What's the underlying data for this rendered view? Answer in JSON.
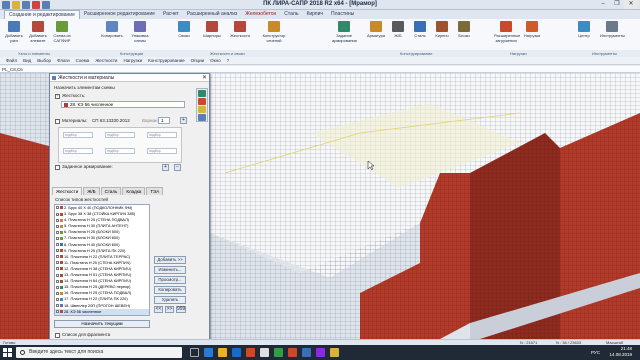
{
  "app": {
    "title": "ПК ЛИРА-САПР  2018 R2 x64 - [Мрамор]",
    "window_controls": [
      "–",
      "❐",
      "✕"
    ]
  },
  "ribbon": {
    "tabs": [
      {
        "label": "Создание и редактирование",
        "active": true
      },
      {
        "label": "Расширенное редактирование"
      },
      {
        "label": "Расчет"
      },
      {
        "label": "Расширенный анализ"
      },
      {
        "label": "Железобетон"
      },
      {
        "label": "Сталь"
      },
      {
        "label": "Кирпич"
      },
      {
        "label": "Пластины"
      }
    ],
    "buttons": [
      {
        "label": "Добавить узел",
        "color": "#4a7ab8"
      },
      {
        "label": "Добавить элемент",
        "color": "#b5473b"
      },
      {
        "label": "Схема из САПФИР",
        "color": "#6a9a3a"
      },
      {
        "label": "Копировать",
        "color": "#5f86c2"
      },
      {
        "label": "Упаковка схемы",
        "color": "#6d6db5"
      },
      {
        "label": "Связи",
        "color": "#3b8cc2"
      },
      {
        "label": "Шарниры",
        "color": "#b5473b"
      },
      {
        "label": "Конструктор сечений",
        "color": "#c98a2a"
      },
      {
        "label": "Задание армирования",
        "color": "#2f8a6a"
      },
      {
        "label": "Жесткости",
        "color": "#b5473b"
      },
      {
        "label": "Арматура",
        "color": "#c98a2a"
      },
      {
        "label": "Ж/Б",
        "color": "#5a5a5a"
      },
      {
        "label": "Сталь",
        "color": "#3b6fb5"
      },
      {
        "label": "Кирпич",
        "color": "#a0522d"
      },
      {
        "label": "Блоки",
        "color": "#7b6a3a"
      },
      {
        "label": "Расширенные загружения",
        "color": "#c94a2a"
      },
      {
        "label": "Нагрузки",
        "color": "#d25a2a"
      },
      {
        "label": "Центр",
        "color": "#3b8cc2"
      },
      {
        "label": "Инструменты",
        "color": "#6a7a8a"
      }
    ],
    "group_labels": [
      "Узлы и элементы",
      "Конструкция",
      "Жесткости и связи",
      "Конструирование",
      "Нагрузки",
      "Инструменты"
    ]
  },
  "menubar": {
    "items": [
      "Файл",
      "Вид",
      "Выбор",
      "Флаги",
      "Схема",
      "Жесткости",
      "Нагрузки",
      "Конструирование",
      "Опции",
      "Окно",
      "?"
    ]
  },
  "document": {
    "tab_label": "PL_C8,C6"
  },
  "dialog": {
    "title": "Жесткости и материалы",
    "assign_header": "Назначить элементам схемы",
    "stiffness_checkbox": "Жесткость:",
    "stiffness_value": "28. КЭ 56 численное",
    "materials_checkbox": "Материалы:",
    "materials_value": "СП 63.13330.2012",
    "variant_label": "Вариант",
    "variant_value": "1",
    "subfields": [
      "подбор",
      "подбор",
      "подбор",
      "подбор",
      "подбор",
      "подбор"
    ],
    "reinforcement_checkbox": "Заданное армирование:",
    "tabs": [
      "Жесткости",
      "Ж/Б",
      "Сталь",
      "Кладка",
      "ТЭА"
    ],
    "list_title": "Список типов жесткостей",
    "list_items": [
      {
        "text": "2. Брус 40 X 40 (ПОДКОЛОННИК ФМ)",
        "color": "#b5473b"
      },
      {
        "text": "3. Брус 38 X 38 (СТОЙКА КИРПИЧ 38б)",
        "color": "#b5473b"
      },
      {
        "text": "4. Пластина H 25 (СТЕНА ПОДВАЛ)",
        "color": "#c98a2a"
      },
      {
        "text": "5. Пластина H 30 (ПЛИТА АНТЕНТ)",
        "color": "#c98a2a"
      },
      {
        "text": "6. Пластина H 25 (БЛОКИ 500)",
        "color": "#6a9a3a"
      },
      {
        "text": "7. Пластина H 30 (БЛОКИ 600)",
        "color": "#6a9a3a"
      },
      {
        "text": "8. Пластина H 40 (БЛОКИ 600)",
        "color": "#3b6fb5"
      },
      {
        "text": "9. Пластина H 25 (ПЛИТА ПК 220)",
        "color": "#c94a2a"
      },
      {
        "text": "10. Пластина H 22 (ПЛИТА ТЕРРАС)",
        "color": "#b5473b"
      },
      {
        "text": "11. Пластина H 25 (СТЕНА КИРПИЧ)",
        "color": "#a0522d"
      },
      {
        "text": "12. Пластина H 38 (СТЕНА КИРПИЧ)",
        "color": "#a0522d"
      },
      {
        "text": "13. Пластина H 51 (СТЕНА КИРПИЧ)",
        "color": "#a0522d"
      },
      {
        "text": "14. Пластина H 64 (СТЕНА КИРПИЧ)",
        "color": "#a0522d"
      },
      {
        "text": "15. Пластина H 25 (ДЕРЕВО перекр)",
        "color": "#2f8a6a"
      },
      {
        "text": "16. Пластина H 25 (СТЕНА ПОДВАЛ)",
        "color": "#c98a2a"
      },
      {
        "text": "17. Пластина H 22 (ПЛИТА ПК 220)",
        "color": "#3b8cc2"
      },
      {
        "text": "18. Швеллер 20П (ПРОГОН ШЕВЕН)",
        "color": "#6d6db5"
      },
      {
        "text": "28. КЭ 56 численное",
        "color": "#b5473b",
        "selected": true
      }
    ],
    "action_buttons": [
      "Добавить >>",
      "Изменить...",
      "Просмотр...",
      "Копировать",
      "Удалить"
    ],
    "icon_buttons": [
      "<<",
      ">>",
      "999"
    ],
    "bottom_button": "Назначить текущим",
    "fragment_checkbox": "Список для фрагмента"
  },
  "viewport": {
    "background": "#dfe3ea",
    "wall_color": "#b23a2a",
    "slab_color": "#f7f7f7",
    "mesh_color": "#7a8aa0",
    "selection_color": "#e0d36a"
  },
  "statusbar": {
    "left": "Готово",
    "mid": "N : 21671",
    "mid2": "N : 38 / 23633",
    "right": "Масштаб"
  },
  "taskbar": {
    "search_placeholder": "Введите здесь текст для поиска",
    "lang": "РУС",
    "time": "21:48",
    "date": "14.08.2019"
  }
}
